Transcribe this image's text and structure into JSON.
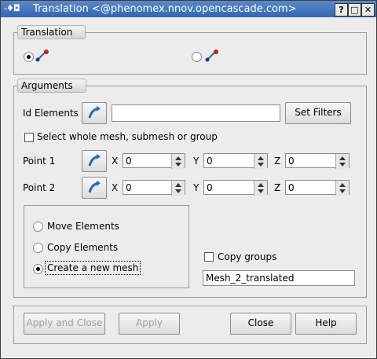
{
  "window": {
    "title_icon": "-♦◘",
    "title": "Translation <@phenomex.nnov.opencascade.com>",
    "buttons": [
      "?",
      "□",
      "✕"
    ]
  },
  "translation_group": {
    "title": "Translation",
    "options": [
      "translation-by-vector",
      "translation-by-two-points"
    ],
    "selected": 0
  },
  "arguments": {
    "title": "Arguments",
    "id_elements_label": "Id Elements",
    "id_elements_value": "",
    "set_filters_label": "Set Filters",
    "select_whole_label": "Select whole mesh, submesh or group",
    "select_whole_checked": false,
    "point1": {
      "label": "Point 1",
      "x_label": "X",
      "x": "0",
      "y_label": "Y",
      "y": "0",
      "z_label": "Z",
      "z": "0"
    },
    "point2": {
      "label": "Point 2",
      "x_label": "X",
      "x": "0",
      "y_label": "Y",
      "y": "0",
      "z_label": "Z",
      "z": "0"
    },
    "action_options": [
      "Move Elements",
      "Copy Elements",
      "Create a new mesh"
    ],
    "action_selected": 2,
    "copy_groups_label": "Copy groups",
    "copy_groups_checked": false,
    "new_mesh_name": "Mesh_2_translated"
  },
  "footer": {
    "apply_close": "Apply and Close",
    "apply": "Apply",
    "close": "Close",
    "help": "Help"
  }
}
